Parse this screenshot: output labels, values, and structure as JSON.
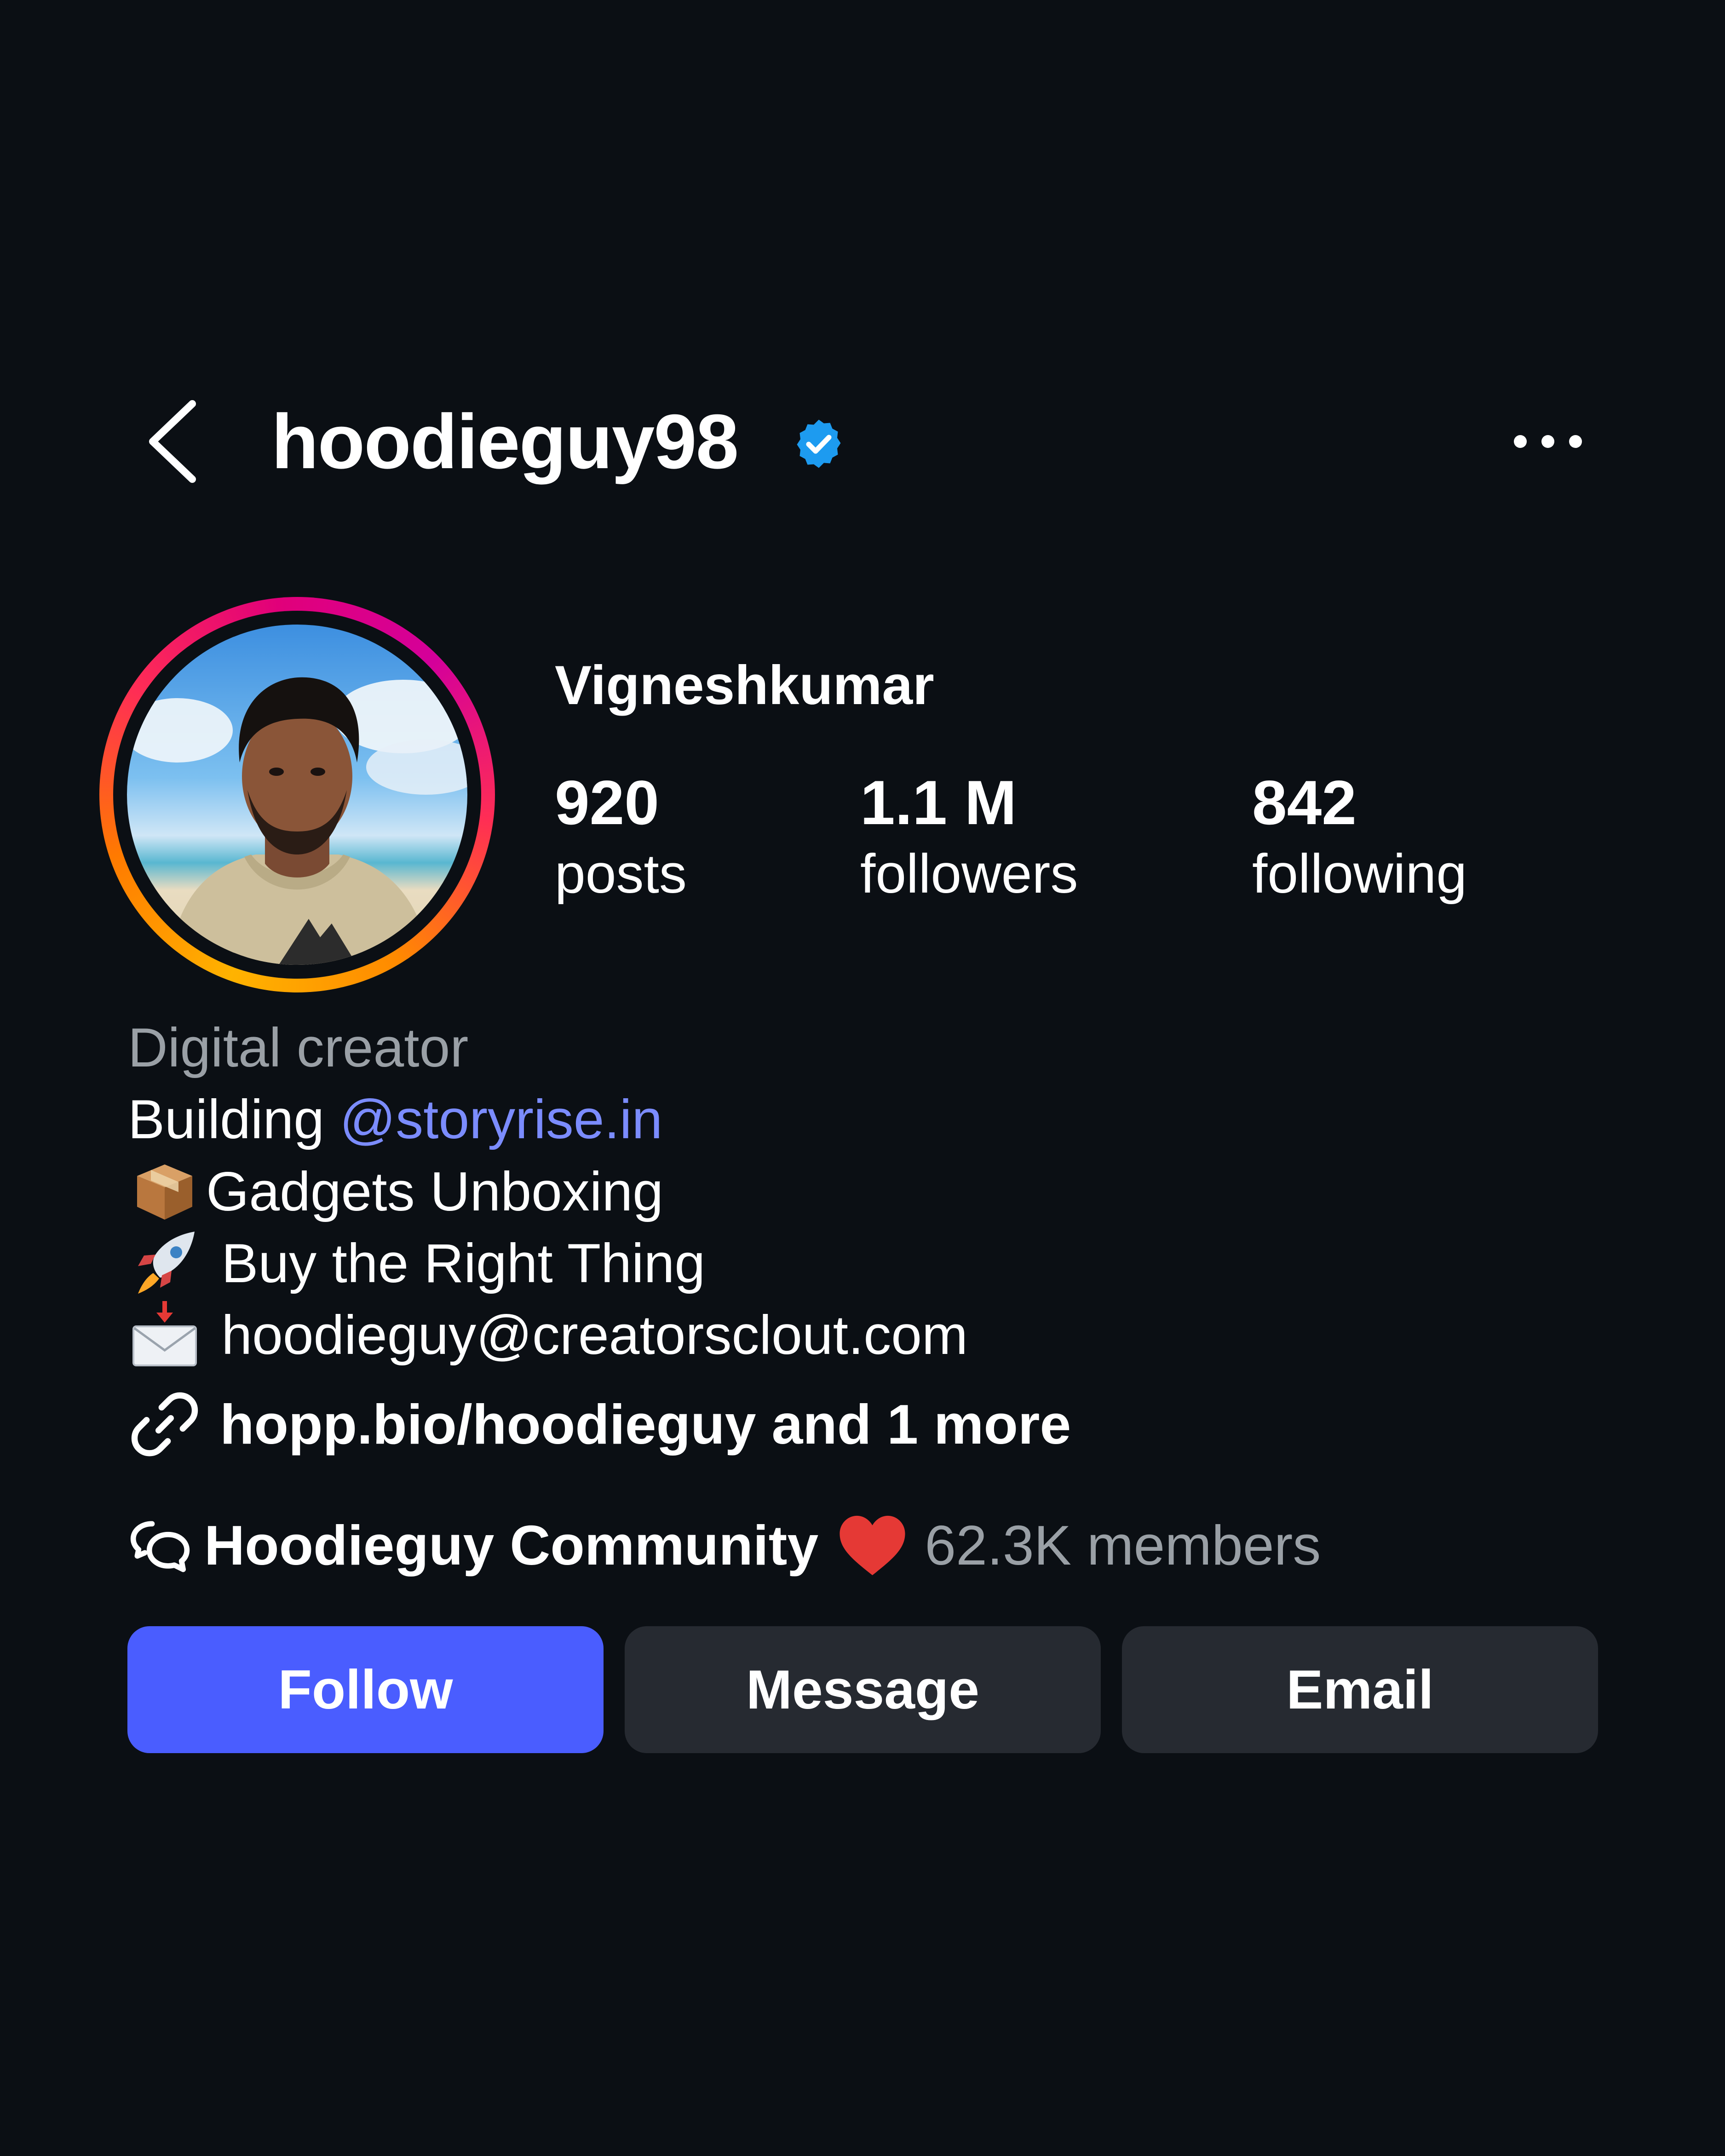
{
  "header": {
    "username": "hoodieguy98",
    "verified": true
  },
  "profile": {
    "display_name": "Vigneshkumar",
    "stats": {
      "posts": {
        "value": "920",
        "label": "posts"
      },
      "followers": {
        "value": "1.1 M",
        "label": "followers"
      },
      "following": {
        "value": "842",
        "label": "following"
      }
    }
  },
  "bio": {
    "category": "Digital creator",
    "line1_prefix": "Building ",
    "line1_mention": "@storyrise.in",
    "line2": "Gadgets Unboxing",
    "line2_icon": "package-icon",
    "line3": " Buy the Right Thing",
    "line3_icon": "rocket-icon",
    "line4": " hoodieguy@creatorsclout.com",
    "line4_icon": "envelope-icon"
  },
  "link": {
    "text": "hopp.bio/hoodieguy and 1 more",
    "icon": "link-icon"
  },
  "community": {
    "name": "Hoodieguy Community",
    "members": "62.3K members",
    "icon": "chat-bubbles-icon",
    "emoji": "heart-icon"
  },
  "actions": {
    "follow": "Follow",
    "message": "Message",
    "email": "Email"
  },
  "colors": {
    "background": "#0b0f14",
    "follow_button": "#4a5dff",
    "secondary_button": "#262a31",
    "mention": "#7b8cff",
    "muted_text": "#9aa0a6",
    "verified_badge": "#1d9bf0"
  }
}
